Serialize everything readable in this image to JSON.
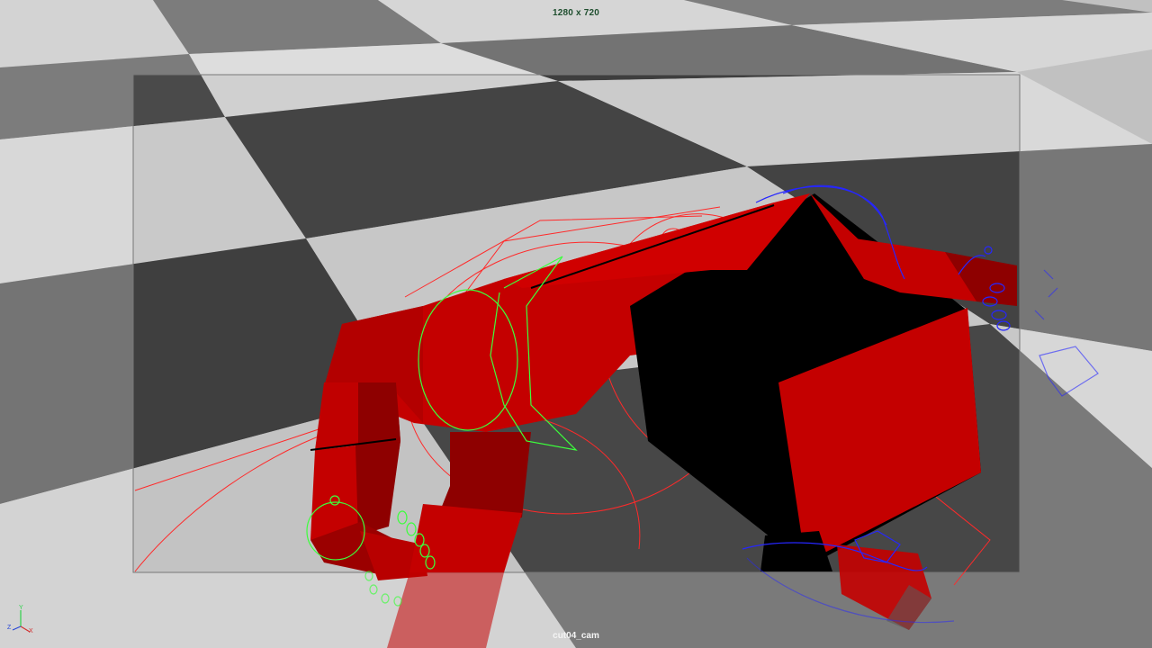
{
  "viewport": {
    "resolution_label": "1280 x 720",
    "camera_label": "cut04_cam"
  },
  "axis_gizmo": {
    "icon": "xyz-axis-icon",
    "x_label": "X",
    "y_label": "Y",
    "z_label": "Z",
    "x_color": "#d23030",
    "y_color": "#2fd24a",
    "z_color": "#2a48d6"
  },
  "colors": {
    "floor_light": "#bdbdbd",
    "floor_dark": "#424242",
    "gate_mask": "#8f8f8f",
    "mesh_red": "#c40000",
    "mesh_dark_red": "#8e0000",
    "control_red": "#ff1e1e",
    "control_green": "#3cff3c",
    "control_blue": "#2424ff"
  }
}
